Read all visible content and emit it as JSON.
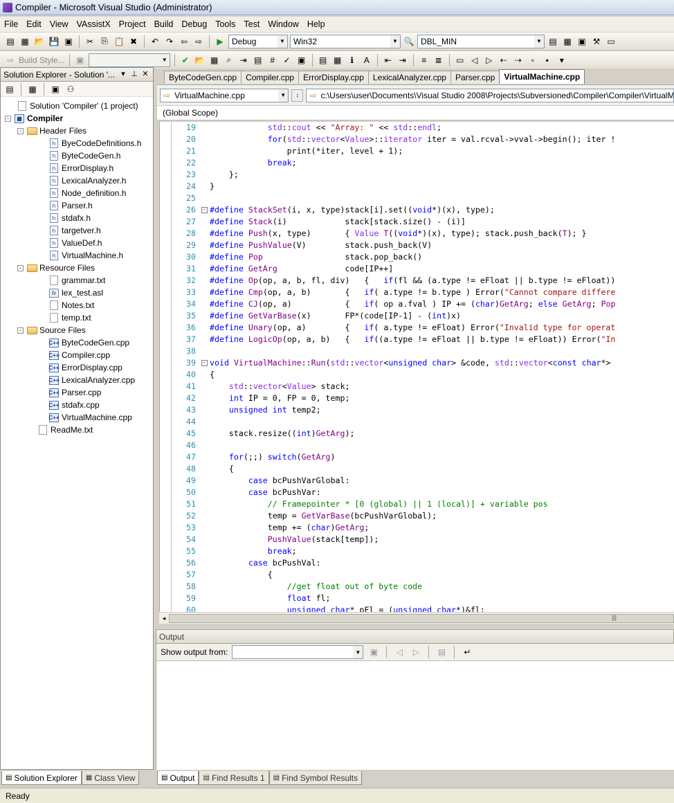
{
  "window": {
    "title": "Compiler - Microsoft Visual Studio (Administrator)"
  },
  "menu": [
    "File",
    "Edit",
    "View",
    "VAssistX",
    "Project",
    "Build",
    "Debug",
    "Tools",
    "Test",
    "Window",
    "Help"
  ],
  "toolbar": {
    "config": "Debug",
    "platform": "Win32",
    "find_value": "DBL_MIN",
    "build_style_label": "Build Style..."
  },
  "solution_explorer": {
    "title": "Solution Explorer - Solution '...",
    "solution_label": "Solution 'Compiler' (1 project)",
    "project_label": "Compiler",
    "folders": [
      {
        "name": "Header Files",
        "files": [
          "ByeCodeDefinitions.h",
          "ByteCodeGen.h",
          "ErrorDisplay.h",
          "LexicalAnalyzer.h",
          "Node_definition.h",
          "Parser.h",
          "stdafx.h",
          "targetver.h",
          "ValueDef.h",
          "VirtualMachine.h"
        ]
      },
      {
        "name": "Resource Files",
        "files": [
          "grammar.txt",
          "lex_test.asl",
          "Notes.txt",
          "temp.txt"
        ]
      },
      {
        "name": "Source Files",
        "files": [
          "ByteCodeGen.cpp",
          "Compiler.cpp",
          "ErrorDisplay.cpp",
          "LexicalAnalyzer.cpp",
          "Parser.cpp",
          "stdafx.cpp",
          "VirtualMachine.cpp"
        ]
      }
    ],
    "root_file": "ReadMe.txt",
    "tabs": [
      "Solution Explorer",
      "Class View"
    ]
  },
  "editor": {
    "tabs": [
      "ByteCodeGen.cpp",
      "Compiler.cpp",
      "ErrorDisplay.cpp",
      "LexicalAnalyzer.cpp",
      "Parser.cpp",
      "VirtualMachine.cpp"
    ],
    "active_tab": "VirtualMachine.cpp",
    "file_combo": "VirtualMachine.cpp",
    "path": "c:\\Users\\user\\Documents\\Visual Studio 2008\\Projects\\Subversioned\\Compiler\\Compiler\\VirtualM",
    "scope": "(Global Scope)",
    "lines": [
      {
        "n": "19",
        "t": "            std::cout << \"Array: \" << std::endl;"
      },
      {
        "n": "20",
        "t": "            for(std::vector<Value>::iterator iter = val.rcval->vval->begin(); iter !"
      },
      {
        "n": "21",
        "t": "                print(*iter, level + 1);"
      },
      {
        "n": "22",
        "t": "            break;"
      },
      {
        "n": "23",
        "t": "    };"
      },
      {
        "n": "24",
        "t": "}"
      },
      {
        "n": "25",
        "t": ""
      },
      {
        "n": "26",
        "t": "#define StackSet(i, x, type)stack[i].set((void*)(x), type);",
        "fold": "-"
      },
      {
        "n": "27",
        "t": "#define Stack(i)            stack[stack.size() - (i)]"
      },
      {
        "n": "28",
        "t": "#define Push(x, type)       { Value T((void*)(x), type); stack.push_back(T); }"
      },
      {
        "n": "29",
        "t": "#define PushValue(V)        stack.push_back(V)"
      },
      {
        "n": "30",
        "t": "#define Pop                 stack.pop_back()"
      },
      {
        "n": "31",
        "t": "#define GetArg              code[IP++]"
      },
      {
        "n": "32",
        "t": "#define Op(op, a, b, fl, div)   {   if(fl && (a.type != eFloat || b.type != eFloat))"
      },
      {
        "n": "33",
        "t": "#define Cmp(op, a, b)       {   if( a.type != b.type ) Error(\"Cannot compare differe"
      },
      {
        "n": "34",
        "t": "#define CJ(op, a)           {   if( op a.fval ) IP += (char)GetArg; else GetArg; Pop"
      },
      {
        "n": "35",
        "t": "#define GetVarBase(x)       FP*(code[IP-1] - (int)x)"
      },
      {
        "n": "36",
        "t": "#define Unary(op, a)        {   if( a.type != eFloat) Error(\"Invalid type for operat"
      },
      {
        "n": "37",
        "t": "#define LogicOp(op, a, b)   {   if((a.type != eFloat || b.type != eFloat)) Error(\"In"
      },
      {
        "n": "38",
        "t": ""
      },
      {
        "n": "39",
        "t": "void VirtualMachine::Run(std::vector<unsigned char> &code, std::vector<const char*> ",
        "fold": "-"
      },
      {
        "n": "40",
        "t": "{"
      },
      {
        "n": "41",
        "t": "    std::vector<Value> stack;"
      },
      {
        "n": "42",
        "t": "    int IP = 0, FP = 0, temp;"
      },
      {
        "n": "43",
        "t": "    unsigned int temp2;"
      },
      {
        "n": "44",
        "t": ""
      },
      {
        "n": "45",
        "t": "    stack.resize((int)GetArg);"
      },
      {
        "n": "46",
        "t": ""
      },
      {
        "n": "47",
        "t": "    for(;;) switch(GetArg)"
      },
      {
        "n": "48",
        "t": "    {"
      },
      {
        "n": "49",
        "t": "        case bcPushVarGlobal:"
      },
      {
        "n": "50",
        "t": "        case bcPushVar:"
      },
      {
        "n": "51",
        "t": "            // Framepointer * [0 (global) || 1 (local)] + variable pos"
      },
      {
        "n": "52",
        "t": "            temp = GetVarBase(bcPushVarGlobal);"
      },
      {
        "n": "53",
        "t": "            temp += (char)GetArg;"
      },
      {
        "n": "54",
        "t": "            PushValue(stack[temp]);"
      },
      {
        "n": "55",
        "t": "            break;"
      },
      {
        "n": "56",
        "t": "        case bcPushVal:"
      },
      {
        "n": "57",
        "t": "            {"
      },
      {
        "n": "58",
        "t": "                //get float out of byte code"
      },
      {
        "n": "59",
        "t": "                float fl;"
      },
      {
        "n": "60",
        "t": "                unsigned char* pFl = (unsigned char*)&fl;"
      }
    ]
  },
  "output": {
    "title": "Output",
    "show_output_from": "Show output from:",
    "tabs": [
      "Output",
      "Find Results 1",
      "Find Symbol Results"
    ]
  },
  "status": "Ready"
}
